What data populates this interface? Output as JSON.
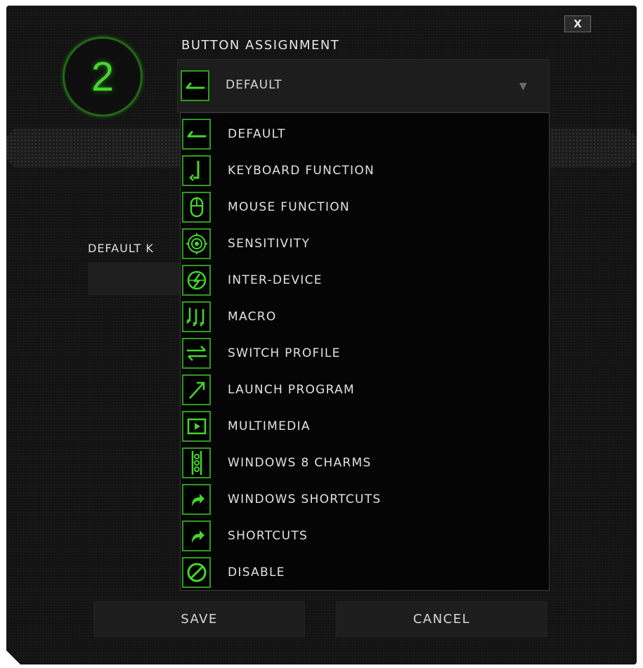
{
  "dialog": {
    "close_label": "X",
    "button_number": "2",
    "title": "BUTTON ASSIGNMENT",
    "accent_color": "#44d62c"
  },
  "select": {
    "value": "DEFAULT",
    "icon": "default-arrow-icon"
  },
  "background_label": "DEFAULT K",
  "options": [
    {
      "label": "DEFAULT",
      "icon": "default-arrow-icon"
    },
    {
      "label": "KEYBOARD FUNCTION",
      "icon": "keyboard-function-icon"
    },
    {
      "label": "MOUSE FUNCTION",
      "icon": "mouse-icon"
    },
    {
      "label": "SENSITIVITY",
      "icon": "target-icon"
    },
    {
      "label": "INTER-DEVICE",
      "icon": "inter-device-icon"
    },
    {
      "label": "MACRO",
      "icon": "macro-icon"
    },
    {
      "label": "SWITCH PROFILE",
      "icon": "switch-profile-icon"
    },
    {
      "label": "LAUNCH PROGRAM",
      "icon": "launch-program-icon"
    },
    {
      "label": "MULTIMEDIA",
      "icon": "multimedia-play-icon"
    },
    {
      "label": "WINDOWS 8 CHARMS",
      "icon": "windows-charms-icon"
    },
    {
      "label": "WINDOWS SHORTCUTS",
      "icon": "shortcut-arrow-icon"
    },
    {
      "label": "SHORTCUTS",
      "icon": "shortcut-arrow-icon"
    },
    {
      "label": "DISABLE",
      "icon": "disable-icon"
    }
  ],
  "footer": {
    "save_label": "SAVE",
    "cancel_label": "CANCEL"
  }
}
